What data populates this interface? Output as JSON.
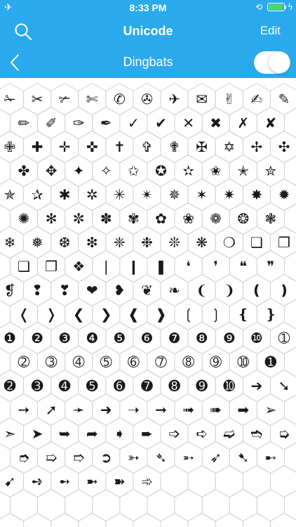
{
  "status_bar": {
    "time": "8:33 PM"
  },
  "nav": {
    "title": "Unicode",
    "edit_label": "Edit",
    "subtitle": "Dingbats",
    "toggle_on": true
  },
  "colors": {
    "header": "#2aa9ec",
    "battery": "#4cd964",
    "grid_line": "#d4d4d4"
  },
  "glyph_rows": [
    [
      "✁",
      "✂",
      "✃",
      "✄",
      "✆",
      "✇",
      "✈",
      "✉",
      "✌",
      "✍",
      "✎"
    ],
    [
      "✏",
      "✐",
      "✑",
      "✒",
      "✓",
      "✔",
      "✕",
      "✖",
      "✗",
      "✘"
    ],
    [
      "✙",
      "✚",
      "✛",
      "✜",
      "✝",
      "✞",
      "✟",
      "✠",
      "✡",
      "✢",
      "✣"
    ],
    [
      "✤",
      "✥",
      "✦",
      "✧",
      "✩",
      "✪",
      "✫",
      "✬",
      "✭",
      "✮"
    ],
    [
      "✯",
      "✰",
      "✱",
      "✲",
      "✳",
      "✴",
      "✵",
      "✶",
      "✷",
      "✸",
      "✹"
    ],
    [
      "✺",
      "✻",
      "✼",
      "✽",
      "✾",
      "✿",
      "❀",
      "❁",
      "❂",
      "❃"
    ],
    [
      "❄",
      "❅",
      "❆",
      "❇",
      "❈",
      "❉",
      "❊",
      "❋",
      "❍",
      "❏",
      "❐"
    ],
    [
      "❑",
      "❒",
      "❖",
      "❘",
      "❙",
      "❚",
      "❛",
      "❜",
      "❝",
      "❞"
    ],
    [
      "❡",
      "❢",
      "❣",
      "❤",
      "❥",
      "❦",
      "❧",
      "❨",
      "❩",
      "❪",
      "❫"
    ],
    [
      "❬",
      "❭",
      "❮",
      "❯",
      "❰",
      "❱",
      "❲",
      "❳",
      "❴",
      "❵"
    ],
    [
      "❶",
      "❷",
      "❸",
      "❹",
      "❺",
      "❻",
      "❼",
      "❽",
      "❾",
      "❿",
      "➀"
    ],
    [
      "➁",
      "➂",
      "➃",
      "➄",
      "➅",
      "➆",
      "➇",
      "➈",
      "➉",
      "➊"
    ],
    [
      "➋",
      "➌",
      "➍",
      "➎",
      "➏",
      "➐",
      "➑",
      "➒",
      "➓",
      "➔",
      "➘"
    ],
    [
      "➙",
      "➚",
      "➛",
      "➜",
      "➝",
      "➞",
      "➟",
      "➠",
      "➡",
      "➢"
    ],
    [
      "➣",
      "➤",
      "➥",
      "➦",
      "➧",
      "➨",
      "➩",
      "➪",
      "➫",
      "➬",
      "➭"
    ],
    [
      "➮",
      "➯",
      "➱",
      "➲",
      "➳",
      "➴",
      "➵",
      "➶",
      "➷",
      "➸"
    ],
    [
      "➹",
      "➺",
      "➻",
      "➼",
      "➽",
      "➾"
    ]
  ]
}
